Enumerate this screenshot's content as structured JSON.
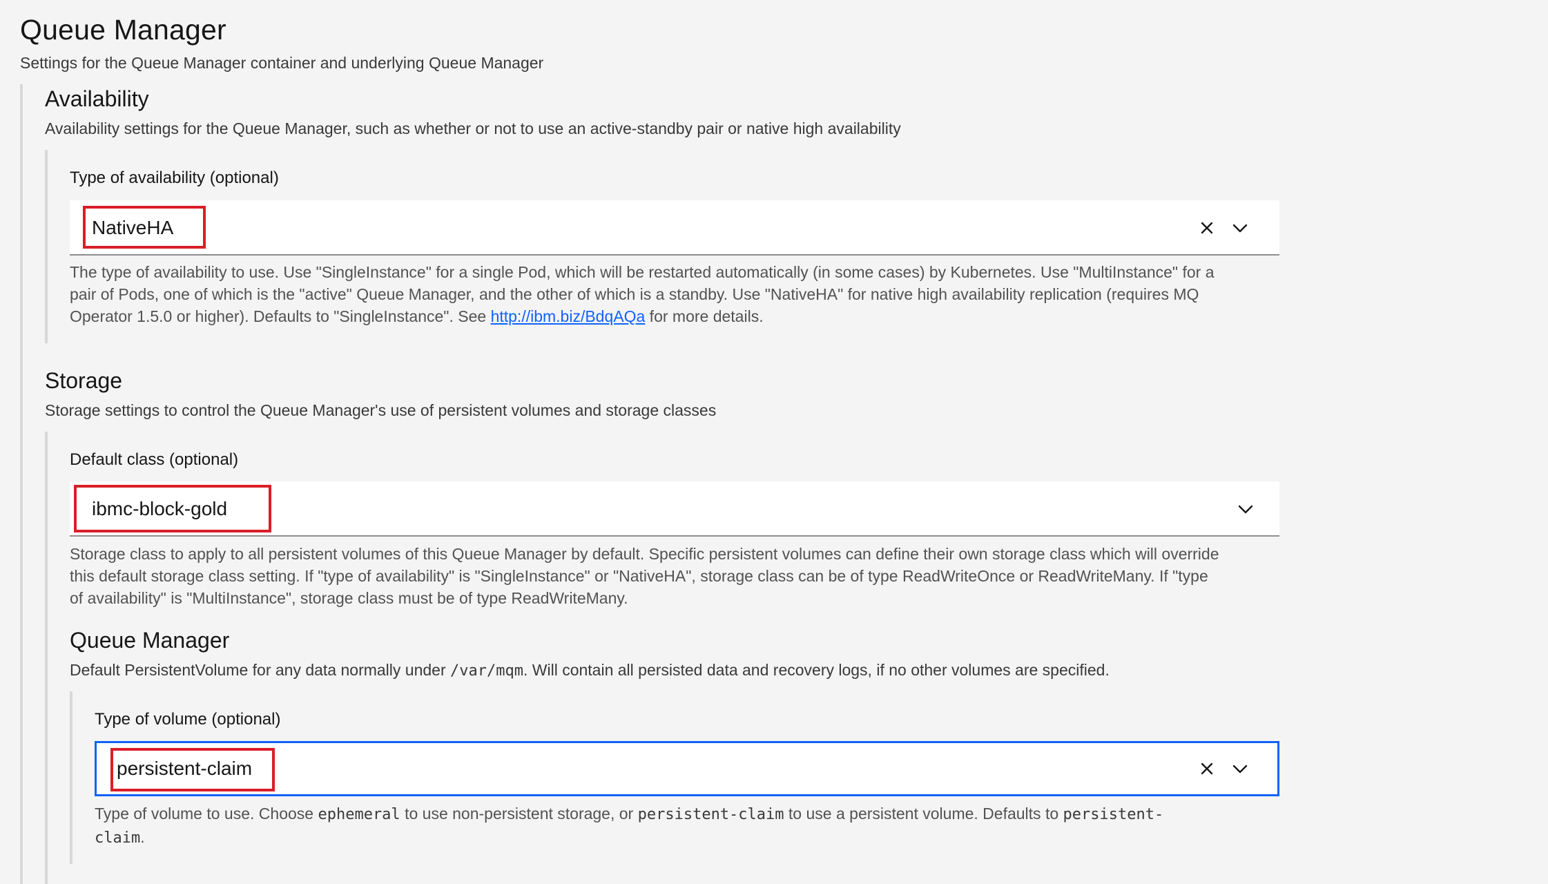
{
  "page": {
    "title": "Queue Manager",
    "subtitle": "Settings for the Queue Manager container and underlying Queue Manager"
  },
  "availability": {
    "heading": "Availability",
    "description": "Availability settings for the Queue Manager, such as whether or not to use an active-standby pair or native high availability",
    "type_label": "Type of availability (optional)",
    "type_value": "NativeHA",
    "help_line1": "The type of availability to use. Use \"SingleInstance\" for a single Pod, which will be restarted automatically (in some cases) by Kubernetes. Use \"MultiInstance\" for a",
    "help_line2": "pair of Pods, one of which is the \"active\" Queue Manager, and the other of which is a standby. Use \"NativeHA\" for native high availability replication (requires MQ",
    "help_line3_pre": "Operator 1.5.0 or higher). Defaults to \"SingleInstance\". See ",
    "help_link": "http://ibm.biz/BdqAQa",
    "help_line3_post": " for more details."
  },
  "storage": {
    "heading": "Storage",
    "description": "Storage settings to control the Queue Manager's use of persistent volumes and storage classes",
    "class_label": "Default class (optional)",
    "class_value": "ibmc-block-gold",
    "help_line1": "Storage class to apply to all persistent volumes of this Queue Manager by default. Specific persistent volumes can define their own storage class which will override",
    "help_line2": "this default storage class setting. If \"type of availability\" is \"SingleInstance\" or \"NativeHA\", storage class can be of type ReadWriteOnce or ReadWriteMany. If \"type",
    "help_line3": "of availability\" is \"MultiInstance\", storage class must be of type ReadWriteMany."
  },
  "queue_manager": {
    "heading": "Queue Manager",
    "desc_pre": "Default PersistentVolume for any data normally under ",
    "desc_code": "/var/mqm",
    "desc_post": ". Will contain all persisted data and recovery logs, if no other volumes are specified.",
    "volume_label": "Type of volume (optional)",
    "volume_value": "persistent-claim",
    "help_pre": "Type of volume to use. Choose ",
    "help_code1": "ephemeral",
    "help_mid": " to use non-persistent storage, or ",
    "help_code2": "persistent-claim",
    "help_mid2": " to use a persistent volume. Defaults to ",
    "help_code3a": "persistent-",
    "help_code3b": "claim",
    "help_end": "."
  },
  "icons": {
    "clear": "close-icon",
    "dropdown": "chevron-down-icon"
  },
  "colors": {
    "highlight": "#da1e28",
    "focus": "#0f62fe",
    "link": "#0f62fe"
  }
}
